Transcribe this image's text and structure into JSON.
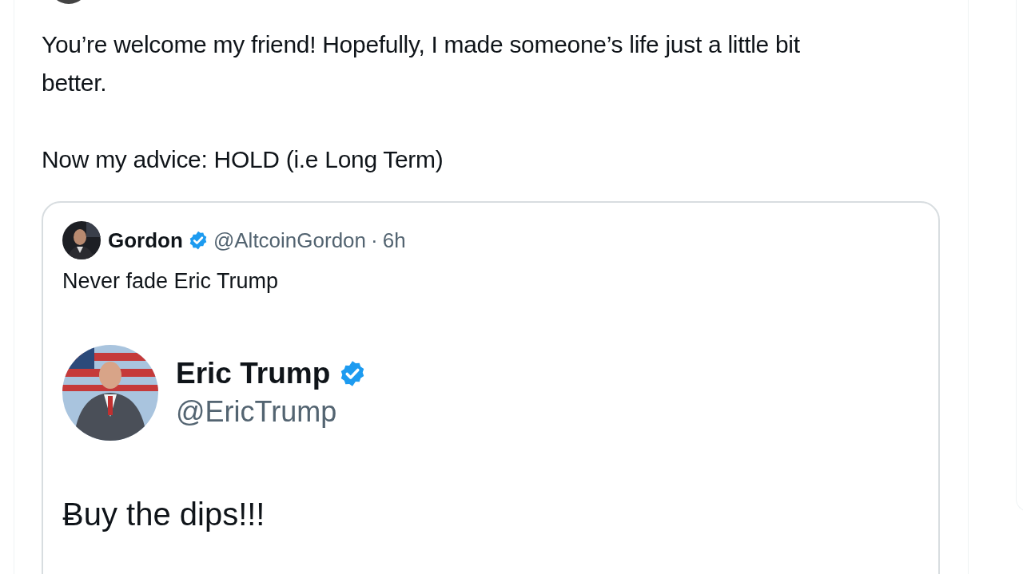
{
  "reply": {
    "paragraphs": [
      "You’re welcome my friend! Hopefully, I made someone’s life just a little bit better.",
      "Now my advice: HOLD (i.e Long Term)"
    ]
  },
  "quote": {
    "name": "Gordon",
    "verified": true,
    "handle": "@AltcoinGordon",
    "separator": "·",
    "time": "6h",
    "text": "Never fade Eric Trump",
    "embedded": {
      "name": "Eric Trump",
      "verified": true,
      "handle": "@EricTrump",
      "text": "Ƀuy the dips!!!"
    }
  }
}
